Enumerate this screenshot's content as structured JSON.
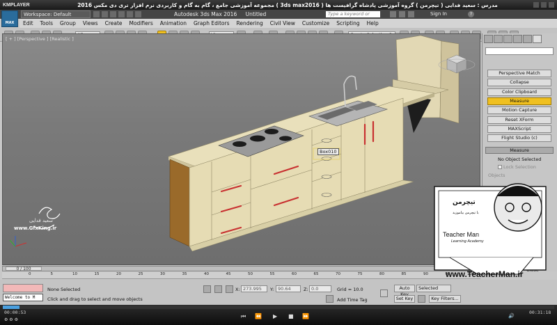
{
  "player": {
    "logo": "KMPLAYER",
    "title": "مجموعه آموزشی جامع ، گام به گام و کاربردی نرم افزار تری دی مکس 2016  ( 3ds max2016 )  مدرس : سعید فدایی ( تیچرمن ) گروه آموزشی پادشاه گرافیست ها",
    "time_elapsed": "00:00:53",
    "time_total": "00:31:18",
    "progress": 0.03
  },
  "max": {
    "logo": "MAX",
    "workspace": "Workspace: Default",
    "app_title": "Autodesk 3ds Max 2016",
    "doc_title": "Untitled",
    "search_placeholder": "Type a keyword or phrase",
    "signin": "Sign In",
    "menu": [
      "Edit",
      "Tools",
      "Group",
      "Views",
      "Create",
      "Modifiers",
      "Animation",
      "Graph Editors",
      "Rendering",
      "Civil View",
      "Customize",
      "Scripting",
      "Help"
    ],
    "toolbar": {
      "filter": "All",
      "refcoord": "View",
      "selection_set": "Create Selection Se"
    },
    "viewport": {
      "label": "[ + ] [Perspective ] [Realistic ]",
      "object_tooltip": "Box010"
    },
    "timeslider": "0 / 100",
    "track_ticks": [
      "0",
      "5",
      "10",
      "15",
      "20",
      "25",
      "30",
      "35",
      "40",
      "45",
      "50",
      "55",
      "60",
      "65",
      "70",
      "75",
      "80",
      "85",
      "90",
      "95",
      "100"
    ],
    "command_panel": {
      "buttons": [
        "Perspective Match",
        "Collapse",
        "Color Clipboard",
        "Measure",
        "Motion Capture",
        "Reset XForm",
        "MAXScript",
        "Flight Studio (c)"
      ],
      "active_button": "Measure",
      "rollout": "Measure",
      "no_selection": "No Object Selected",
      "lock": "Lock Selection",
      "objects": "Objects"
    },
    "status": {
      "listener": "Welcome to M",
      "none_selected": "None Selected",
      "prompt": "Click and drag to select and move objects",
      "x_label": "X:",
      "x_value": "273.995",
      "y_label": "Y:",
      "y_value": "90.64",
      "z_label": "Z:",
      "z_value": "0.0",
      "grid": "Grid = 10.0",
      "add_time_tag": "Add Time Tag",
      "auto_key": "Auto Key",
      "selected": "Selected",
      "set_key": "Set Key",
      "key_filters": "Key Filters...",
      "close": "Close"
    }
  },
  "watermark": {
    "author_fa": "سعید فدایی",
    "site": "www.GfxKing.ir",
    "teacher": "Teacher Man",
    "teacher_fa": "تیچرمن",
    "teacher_tagline_fa": "با تیچرمن بیاموزید",
    "learning": "Learning Academy",
    "teacher_url": "www.TeacherMan.ir"
  },
  "colors": {
    "accent": "#f0c020",
    "cabinet": "#e6dcb4",
    "handle": "#c83030",
    "wood": "#9a6a2a"
  }
}
